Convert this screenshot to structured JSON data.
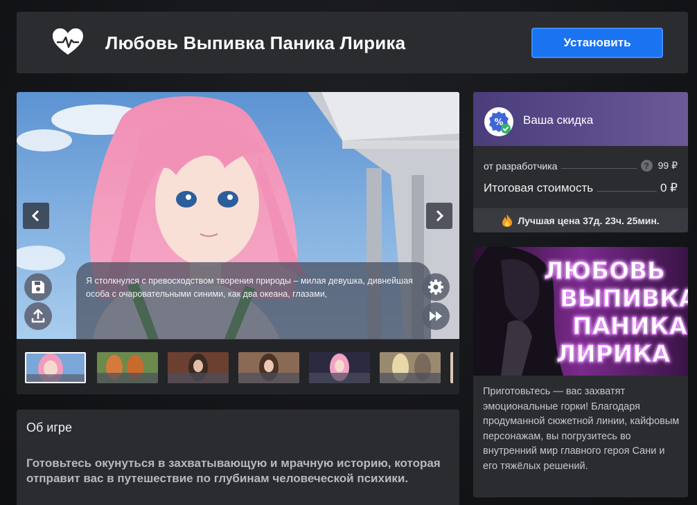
{
  "header": {
    "title": "Любовь Выпивка Паника Лирика",
    "install_label": "Установить",
    "logo_icon": "heart-pulse-icon"
  },
  "gallery": {
    "dialog_text": "Я столкнулся с превосходством творения природы – милая девушка, дивнейшая особа с очаровательными синими, как два океана, глазами,",
    "thumbnail_count": 6,
    "active_thumbnail": 1,
    "icons": [
      "chevron-left-icon",
      "chevron-right-icon",
      "save-icon",
      "upload-icon",
      "gear-icon",
      "fast-forward-icon"
    ]
  },
  "about": {
    "title": "Об игре",
    "text": "Готовьтесь окунуться в захватывающую и мрачную историю, которая отправит вас в путешествие по глубинам человеческой психики."
  },
  "discount": {
    "title": "Ваша скидка",
    "developer_label": "от разработчика",
    "developer_price": "99 ₽",
    "total_label": "Итоговая стоимость",
    "total_price": "0 ₽",
    "best_price": "Лучшая цена 37д. 23ч. 25мин."
  },
  "promo": {
    "art_lines": [
      "ЛЮБОВЬ",
      "ВЫПИВКА",
      "ПАНИКА",
      "ЛИРИКА"
    ],
    "description": "Приготовьтесь — вас захватят эмоциональные горки! Благодаря продуманной сюжетной линии, кайфовым персонажам, вы погрузитесь во внутренний мир главного героя Сани и его тяжёлых решений."
  },
  "colors": {
    "accent": "#1a73f0",
    "panel": "#2b2c30",
    "neon": "#ffffff",
    "neon_glow": "#d04bff"
  }
}
